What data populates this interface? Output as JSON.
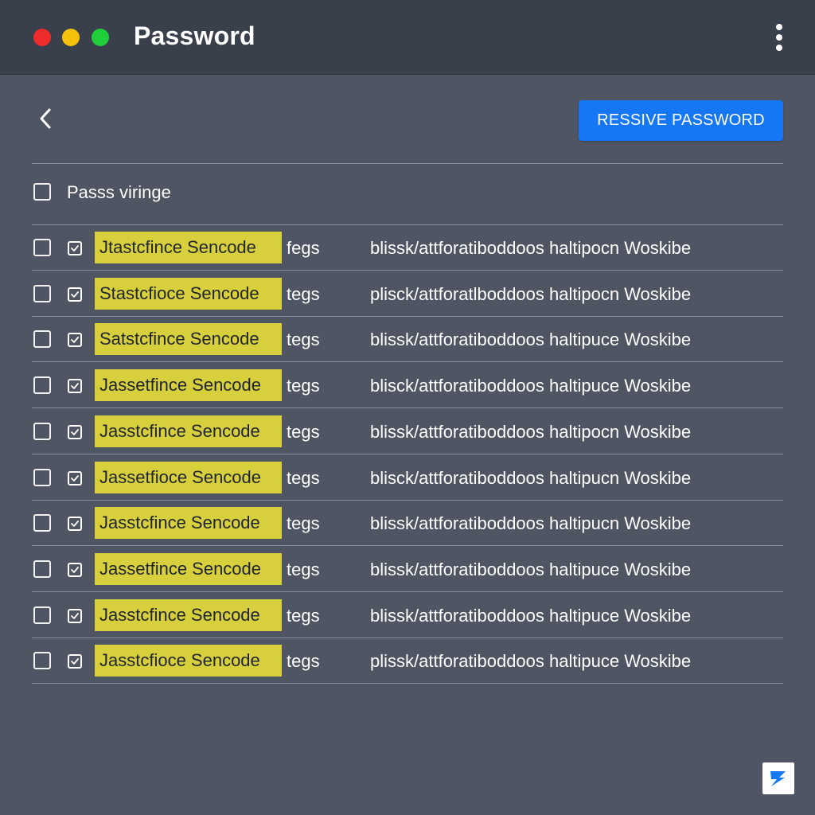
{
  "window": {
    "title": "Password"
  },
  "toolbar": {
    "primary_button_label": "RESSIVE PASSWORD"
  },
  "list": {
    "header_label": "Passs viringe",
    "rows": [
      {
        "name": "Jtastcfince Sencode",
        "tag": "fegs",
        "path": "blissk/attforatiboddoos haltipocn Woskibe"
      },
      {
        "name": "Stastcfioce Sencode",
        "tag": "tegs",
        "path": "plisck/attforatlboddoos haltipocn Woskibe"
      },
      {
        "name": "Satstcfince Sencode",
        "tag": "tegs",
        "path": "blissk/attforatiboddoos haltipuce Woskibe"
      },
      {
        "name": "Jassetfince Sencode",
        "tag": "tegs",
        "path": "blisck/attforatiboddoos haltipuce Woskibe"
      },
      {
        "name": "Jasstcfince Sencode",
        "tag": "tegs",
        "path": "blissk/attforatiboddoos haltipocn Woskibe"
      },
      {
        "name": "Jassetfioce Sencode",
        "tag": "tegs",
        "path": "blisck/attforatiboddoos haltipucn Woskibe"
      },
      {
        "name": "Jasstcfince Sencode",
        "tag": "tegs",
        "path": "blissk/attforatiboddoos haltipucn Woskibe"
      },
      {
        "name": "Jassetfince Sencode",
        "tag": "tegs",
        "path": "blissk/attforatiboddoos haltipuce Woskibe"
      },
      {
        "name": "Jasstcfince Sencode",
        "tag": "tegs",
        "path": "blissk/attforatiboddoos haltipuce Woskibe"
      },
      {
        "name": "Jasstcfioce Sencode",
        "tag": "tegs",
        "path": "plissk/attforatiboddoos haltipuce Woskibe"
      }
    ]
  },
  "icons": {
    "back": "chevron-left-icon",
    "menu": "kebab-menu-icon",
    "row_action": "edit-square-icon",
    "corner_logo": "app-logo-icon"
  },
  "colors": {
    "background": "#4f5563",
    "titlebar": "#3a404b",
    "accent": "#1677f5",
    "highlight": "#d7cf3c",
    "traffic_red": "#ef2c2c",
    "traffic_yellow": "#f4c20d",
    "traffic_green": "#1fce3a"
  }
}
